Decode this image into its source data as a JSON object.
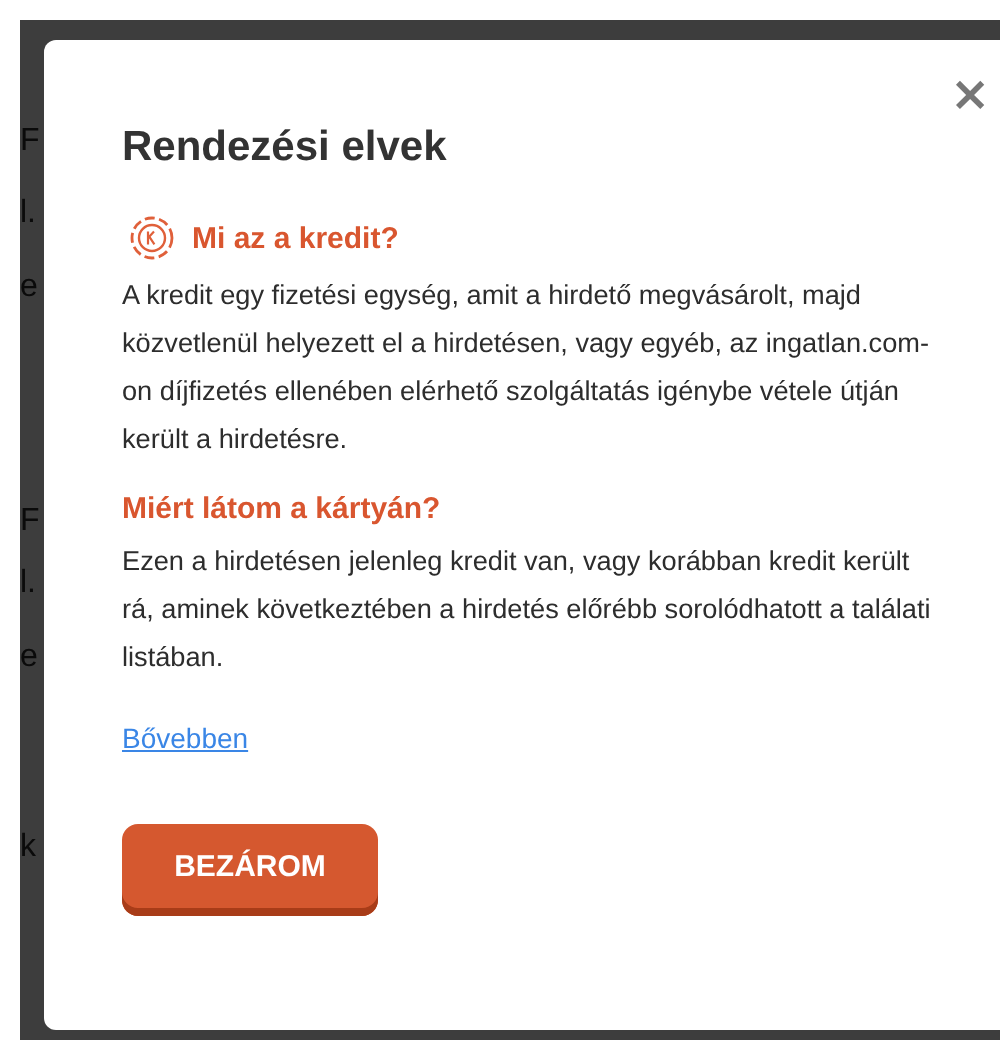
{
  "background": {
    "fragments": [
      {
        "text": "F"
      },
      {
        "text": "l."
      },
      {
        "text": "e"
      },
      {
        "text": "F"
      },
      {
        "text": "l."
      },
      {
        "text": "e"
      },
      {
        "text": "k"
      }
    ]
  },
  "dialog": {
    "title": "Rendezési elvek",
    "close": "×",
    "sections": [
      {
        "heading": "Mi az a kredit?",
        "icon": true,
        "text": "A kredit egy fizetési egység, amit a hirdető megvásárolt, majd közvetlenül helyezett el a hirdetésen, vagy egyéb, az ingatlan.com-on díjfizetés ellenében elérhető szolgáltatás igénybe vétele útján került a hirdetésre."
      },
      {
        "heading": "Miért látom a kártyán?",
        "icon": false,
        "text": "Ezen a hirdetésen jelenleg kredit van, vagy korábban kredit került rá, aminek következtében a hirdetés előrébb sorolódhatott a találati listában."
      }
    ],
    "link": "Bővebben",
    "button": "BEZÁROM"
  }
}
